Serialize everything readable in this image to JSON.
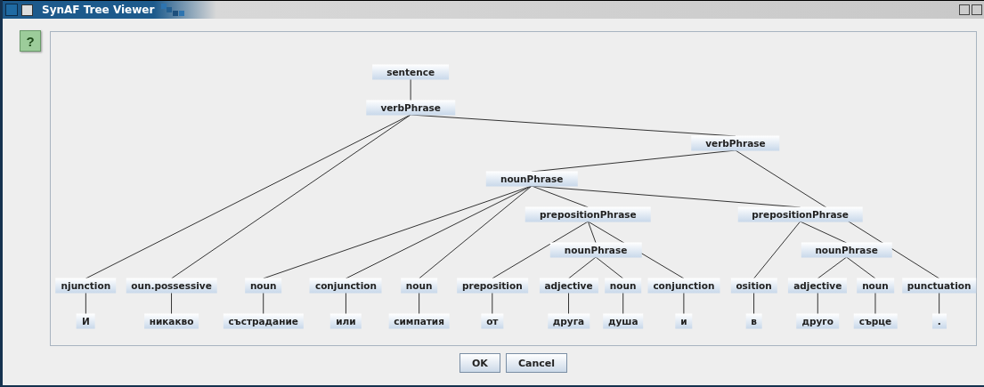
{
  "window": {
    "title": "SynAF Tree Viewer"
  },
  "help_button": {
    "label": "?"
  },
  "tree": {
    "label": "sentence",
    "children": [
      {
        "label": "verbPhrase",
        "children": [
          {
            "label": "njunction",
            "word": "И"
          },
          {
            "label": "oun.possessive",
            "word": "никакво"
          },
          {
            "label": "verbPhrase",
            "children": [
              {
                "label": "nounPhrase",
                "children": [
                  {
                    "label": "noun",
                    "word": "състрадание"
                  },
                  {
                    "label": "conjunction",
                    "word": "или"
                  },
                  {
                    "label": "noun",
                    "word": "симпатия"
                  },
                  {
                    "label": "prepositionPhrase",
                    "children": [
                      {
                        "label": "preposition",
                        "word": "от"
                      },
                      {
                        "label": "nounPhrase",
                        "children": [
                          {
                            "label": "adjective",
                            "word": "друга"
                          },
                          {
                            "label": "noun",
                            "word": "душа"
                          }
                        ]
                      },
                      {
                        "label": "conjunction",
                        "word": "и"
                      }
                    ]
                  },
                  {
                    "label": "prepositionPhrase",
                    "children": [
                      {
                        "label": "osition",
                        "word": "в"
                      },
                      {
                        "label": "nounPhrase",
                        "children": [
                          {
                            "label": "adjective",
                            "word": "друго"
                          },
                          {
                            "label": "noun",
                            "word": "сърце"
                          }
                        ]
                      }
                    ]
                  }
                ]
              },
              {
                "label": "punctuation",
                "word": "."
              }
            ]
          }
        ]
      }
    ]
  },
  "buttons": [
    "OK",
    "Cancel"
  ]
}
